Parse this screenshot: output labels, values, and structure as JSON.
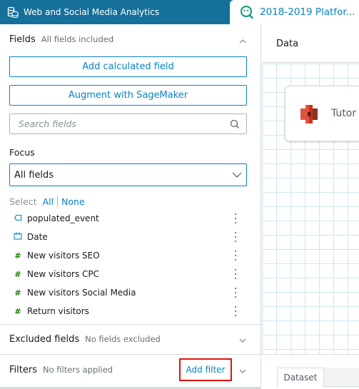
{
  "topbar": {
    "dataset_name": "Web and Social Media Analytics",
    "active_tab_label": "2018-2019 Platfor..."
  },
  "fields_section": {
    "title": "Fields",
    "subtitle": "All fields included",
    "add_calculated_field_label": "Add calculated field",
    "augment_label": "Augment with SageMaker",
    "search_placeholder": "Search fields",
    "focus_label": "Focus",
    "focus_value": "All fields",
    "select_label": "Select",
    "select_all_label": "All",
    "select_none_label": "None",
    "items": [
      {
        "name": "populated_event",
        "type": "string",
        "icon": "string-field-icon"
      },
      {
        "name": "Date",
        "type": "date",
        "icon": "calendar-icon"
      },
      {
        "name": "New visitors SEO",
        "type": "number",
        "icon": "hash-icon"
      },
      {
        "name": "New visitors CPC",
        "type": "number",
        "icon": "hash-icon"
      },
      {
        "name": "New visitors Social Media",
        "type": "number",
        "icon": "hash-icon"
      },
      {
        "name": "Return visitors",
        "type": "number",
        "icon": "hash-icon"
      }
    ]
  },
  "excluded_section": {
    "title": "Excluded fields",
    "subtitle": "No fields excluded"
  },
  "filters_section": {
    "title": "Filters",
    "subtitle": "No filters applied",
    "add_filter_label": "Add filter"
  },
  "data_panel": {
    "title": "Data",
    "node_label": "Tutor",
    "bottom_tab_label": "Dataset"
  },
  "colors": {
    "topbar": "#15709a",
    "accent": "#0a83c3",
    "number_icon": "#1d8102",
    "highlight_box": "#e0120c",
    "s3_icon": "#d13212"
  }
}
